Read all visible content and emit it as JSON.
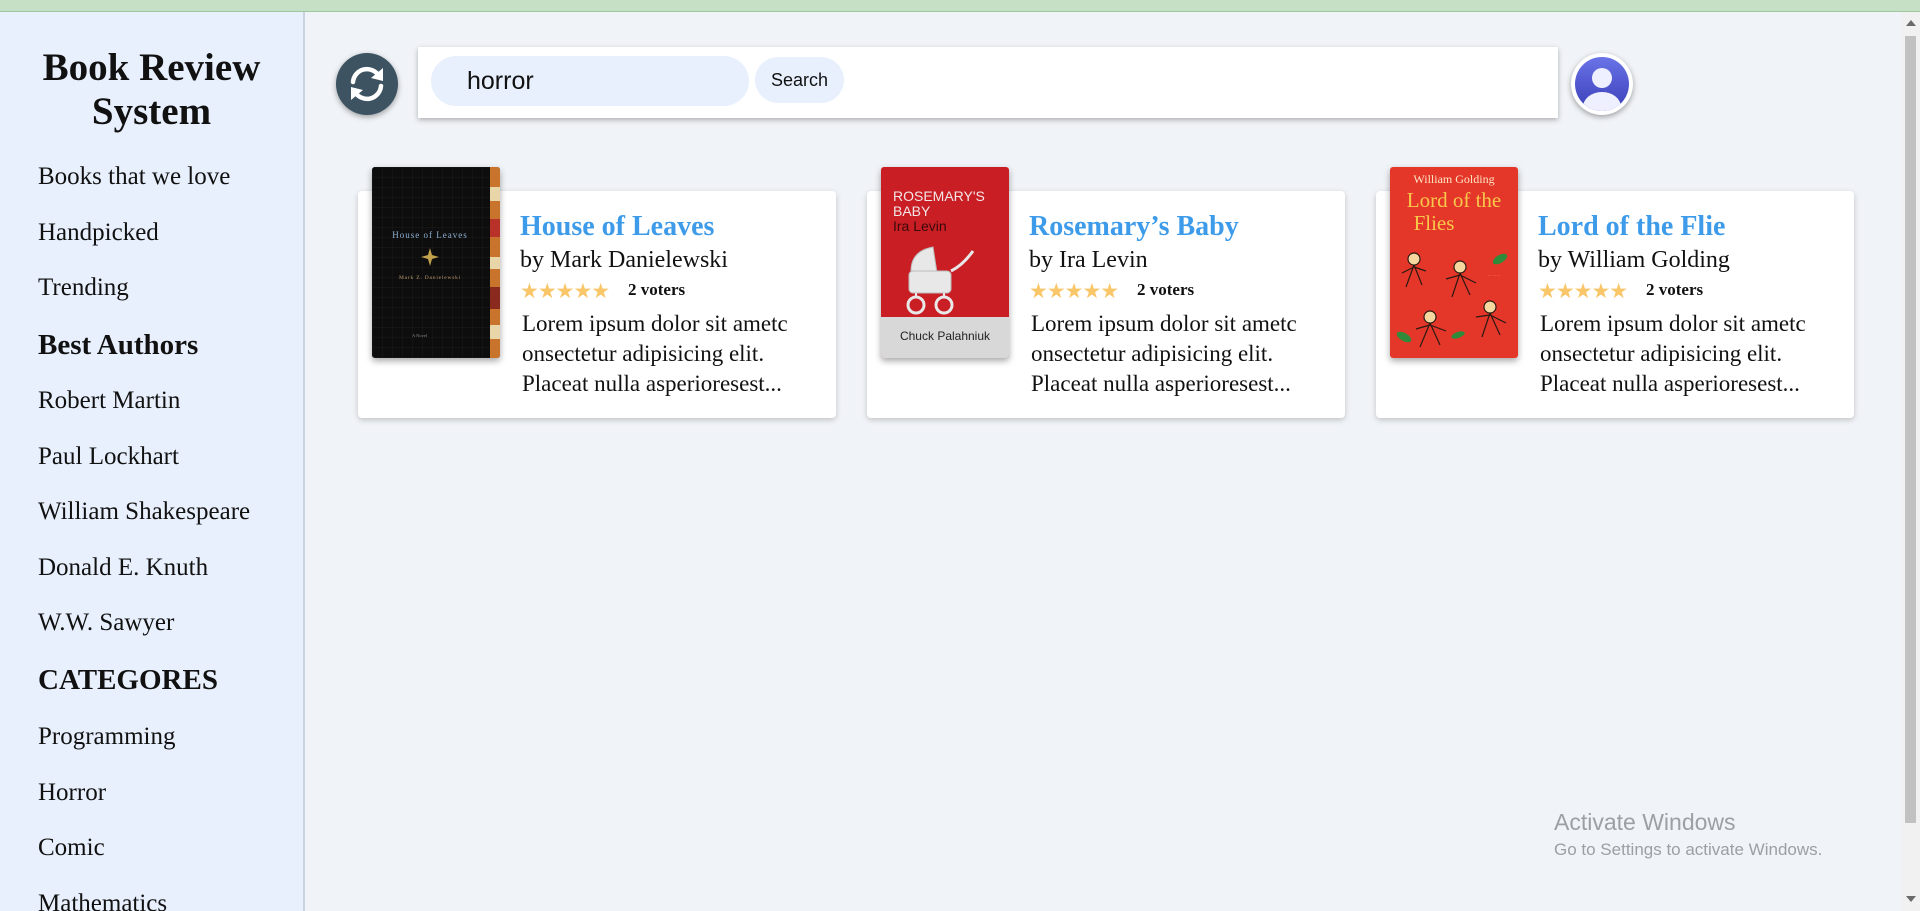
{
  "app": {
    "title": "Book Review System"
  },
  "sidebar": {
    "links": [
      {
        "label": "Books that we love"
      },
      {
        "label": "Handpicked"
      },
      {
        "label": "Trending"
      }
    ],
    "authors_heading": "Best Authors",
    "authors": [
      {
        "label": "Robert Martin"
      },
      {
        "label": "Paul Lockhart"
      },
      {
        "label": "William Shakespeare"
      },
      {
        "label": "Donald E. Knuth"
      },
      {
        "label": "W.W. Sawyer"
      }
    ],
    "categories_heading": "CATEGORES",
    "categories": [
      {
        "label": "Programming"
      },
      {
        "label": "Horror"
      },
      {
        "label": "Comic"
      },
      {
        "label": "Mathematics"
      }
    ]
  },
  "search": {
    "value": "horror",
    "button_label": "Search"
  },
  "books": [
    {
      "title": "House of Leaves",
      "author": "by Mark Danielewski",
      "stars": "★★★★★",
      "voters": "2 voters",
      "description": "Lorem ipsum dolor sit ametc onsectetur adipisicing elit. Placeat nulla asperioresest...",
      "cover": {
        "title": "House of Leaves",
        "author": "Mark Z. Danielewski",
        "caption": "A Novel"
      }
    },
    {
      "title": "Rosemary’s Baby",
      "author": "by Ira Levin",
      "stars": "★★★★★",
      "voters": "2 voters",
      "description": "Lorem ipsum dolor sit ametc onsectetur adipisicing elit. Placeat nulla asperioresest...",
      "cover": {
        "title_line1": "ROSEMARY'S",
        "title_line2": "BABY",
        "author": "Ira Levin",
        "footer": "Chuck Palahniuk"
      }
    },
    {
      "title": "Lord of the Flie",
      "author": "by William Golding",
      "stars": "★★★★★",
      "voters": "2 voters",
      "description": "Lorem ipsum dolor sit ametc onsectetur adipisicing elit. Placeat nulla asperioresest...",
      "cover": {
        "author": "William Golding",
        "title_line1": "Lord of the",
        "title_line2": "Flies"
      }
    }
  ],
  "watermark": {
    "line1": "Activate Windows",
    "line2": "Go to Settings to activate Windows."
  },
  "icons": {
    "sync": "sync-icon",
    "avatar": "user-avatar-icon",
    "star": "star-icon"
  },
  "colors": {
    "accent": "#3d9be9",
    "sidebar_bg": "#e8f0fd",
    "star": "#f9c66a",
    "sync_bg": "#3d5361"
  }
}
